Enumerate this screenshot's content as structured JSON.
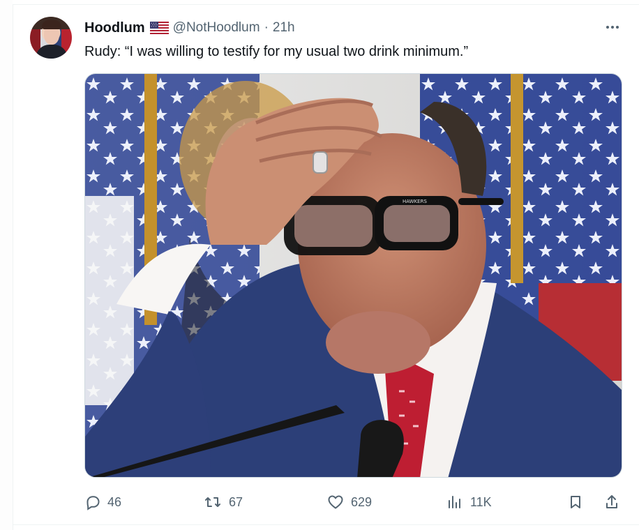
{
  "tweet": {
    "display_name": "Hoodlum",
    "handle": "@NotHoodlum",
    "separator": "·",
    "time": "21h",
    "text": "Rudy: “I was willing to testify for my usual two drink minimum.”",
    "glasses_brand": "HAWKERS"
  },
  "actions": {
    "replies": "46",
    "reposts": "67",
    "likes": "629",
    "views": "11K"
  },
  "icons": {
    "verified_flag": "us-flag-icon",
    "more": "more-icon",
    "reply": "reply-icon",
    "repost": "repost-icon",
    "like": "heart-icon",
    "views": "views-icon",
    "bookmark": "bookmark-icon",
    "share": "share-icon"
  },
  "colors": {
    "secondary_text": "#536471",
    "border": "#eff3f4"
  }
}
